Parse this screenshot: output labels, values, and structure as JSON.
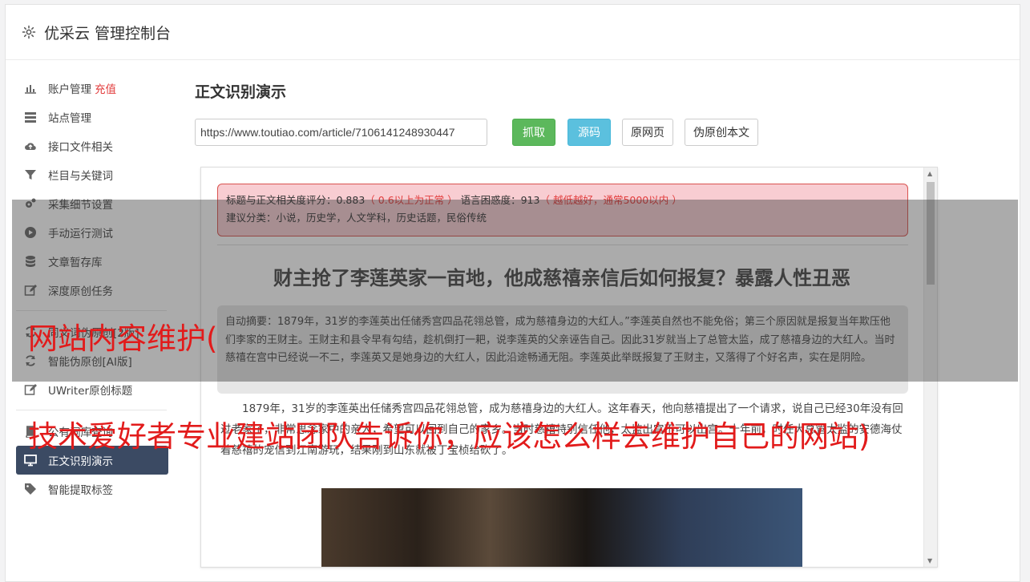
{
  "header": {
    "title": "优采云 管理控制台",
    "icon": "gear-icon"
  },
  "sidebar": {
    "items": [
      {
        "label": "账户管理",
        "badge": "充值",
        "icon": "bar-chart-icon"
      },
      {
        "label": "站点管理",
        "icon": "server-icon"
      },
      {
        "label": "接口文件相关",
        "icon": "cloud-upload-icon"
      },
      {
        "label": "栏目与关键词",
        "icon": "filter-icon"
      },
      {
        "label": "采集细节设置",
        "icon": "cogs-icon"
      },
      {
        "label": "手动运行测试",
        "icon": "play-circle-icon"
      },
      {
        "label": "文章暂存库",
        "icon": "database-icon"
      },
      {
        "label": "深度原创任务",
        "icon": "edit-icon"
      },
      {
        "label": "同义词伪原创[2版]",
        "icon": "refresh-icon"
      },
      {
        "label": "智能伪原创[AI版]",
        "icon": "refresh-icon"
      },
      {
        "label": "UWriter原创标题",
        "icon": "edit-icon"
      },
      {
        "label": "公有词库查询",
        "icon": "book-icon"
      },
      {
        "label": "正文识别演示",
        "icon": "monitor-icon",
        "active": true
      },
      {
        "label": "智能提取标签",
        "icon": "tag-icon"
      }
    ]
  },
  "main": {
    "page_title": "正文识别演示",
    "url_value": "https://www.toutiao.com/article/7106141248930447",
    "buttons": {
      "fetch": "抓取",
      "source": "源码",
      "original": "原网页",
      "pseudo": "伪原创本文"
    }
  },
  "preview": {
    "relevance_label": "标题与正文相关度评分：0.883",
    "relevance_hint": "（ 0.6以上为正常 ）",
    "perplexity_label": " 语言困惑度：913",
    "perplexity_hint": "（ 越低越好，通常5000以内 ）",
    "category": "建议分类：小说，历史学，人文学科，历史话题，民俗传统",
    "headline": "财主抢了李莲英家一亩地，他成慈禧亲信后如何报复？暴露人性丑恶",
    "summary": "自动摘要：1879年，31岁的李莲英出任储秀宫四品花翎总管，成为慈禧身边的大红人。”李莲英自然也不能免俗；第三个原因就是报复当年欺压他们李家的王财主。王财主和县令早有勾结，趁机倒打一耙，说李莲英的父亲诬告自己。因此31岁就当上了总管太监，成了慈禧身边的大红人。当时慈禧在宫中已经说一不二，李莲英又是她身边的大红人，因此沿途畅通无阻。李莲英此举既报复了王财主，又落得了个好名声，实在是阴险。",
    "body": "1879年，31岁的李莲英出任储秀宫四品花翎总管，成为慈禧身边的大红人。这年春天，他向慈禧提出了一个请求，说自己已经30年没有回过老家了，非常思念家中的亲人，希望可以回到自己的家乡。当时慈禧特别信任他，太监出宫不可以出宫。十年前，时任大总管太监的安德海仗着慈禧的宠信到江南游玩，结果刚到山东就被丁宝桢给砍了。"
  },
  "overlay": {
    "line1": "网站内容维护(",
    "line2": "技术爱好者专业建站团队告诉你，应该怎么样去维护自己的网站)"
  }
}
